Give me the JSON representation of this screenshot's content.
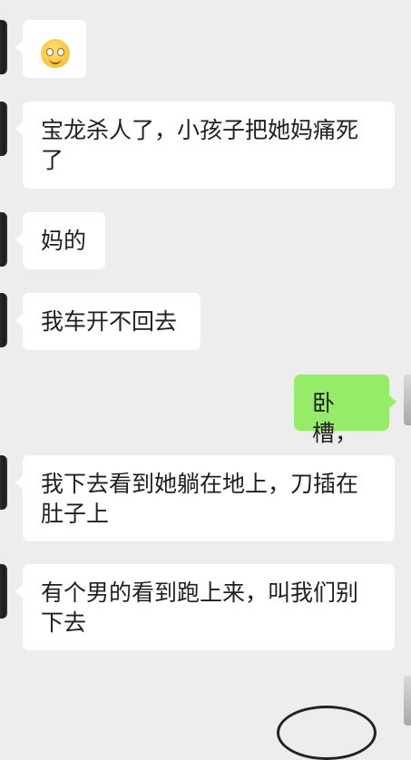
{
  "chat": {
    "messages": [
      {
        "side": "left",
        "type": "emoji",
        "emoji": "grinning-face-icon"
      },
      {
        "side": "left",
        "type": "text",
        "lines": [
          "宝龙杀人了，小孩子把她妈痛死",
          "了"
        ]
      },
      {
        "side": "left",
        "type": "text",
        "lines": [
          "妈的"
        ]
      },
      {
        "side": "left",
        "type": "text",
        "lines": [
          "我车开不回去"
        ]
      },
      {
        "side": "right",
        "type": "text",
        "lines": [
          "卧槽，"
        ]
      },
      {
        "side": "left",
        "type": "text",
        "lines": [
          "我下去看到她躺在地上，刀插在",
          "肚子上"
        ]
      },
      {
        "side": "left",
        "type": "text",
        "lines": [
          "有个男的看到跑上来，叫我们别",
          "下去"
        ]
      }
    ]
  },
  "colors": {
    "background": "#ededed",
    "incoming_bubble": "#ffffff",
    "outgoing_bubble": "#95ec69"
  }
}
